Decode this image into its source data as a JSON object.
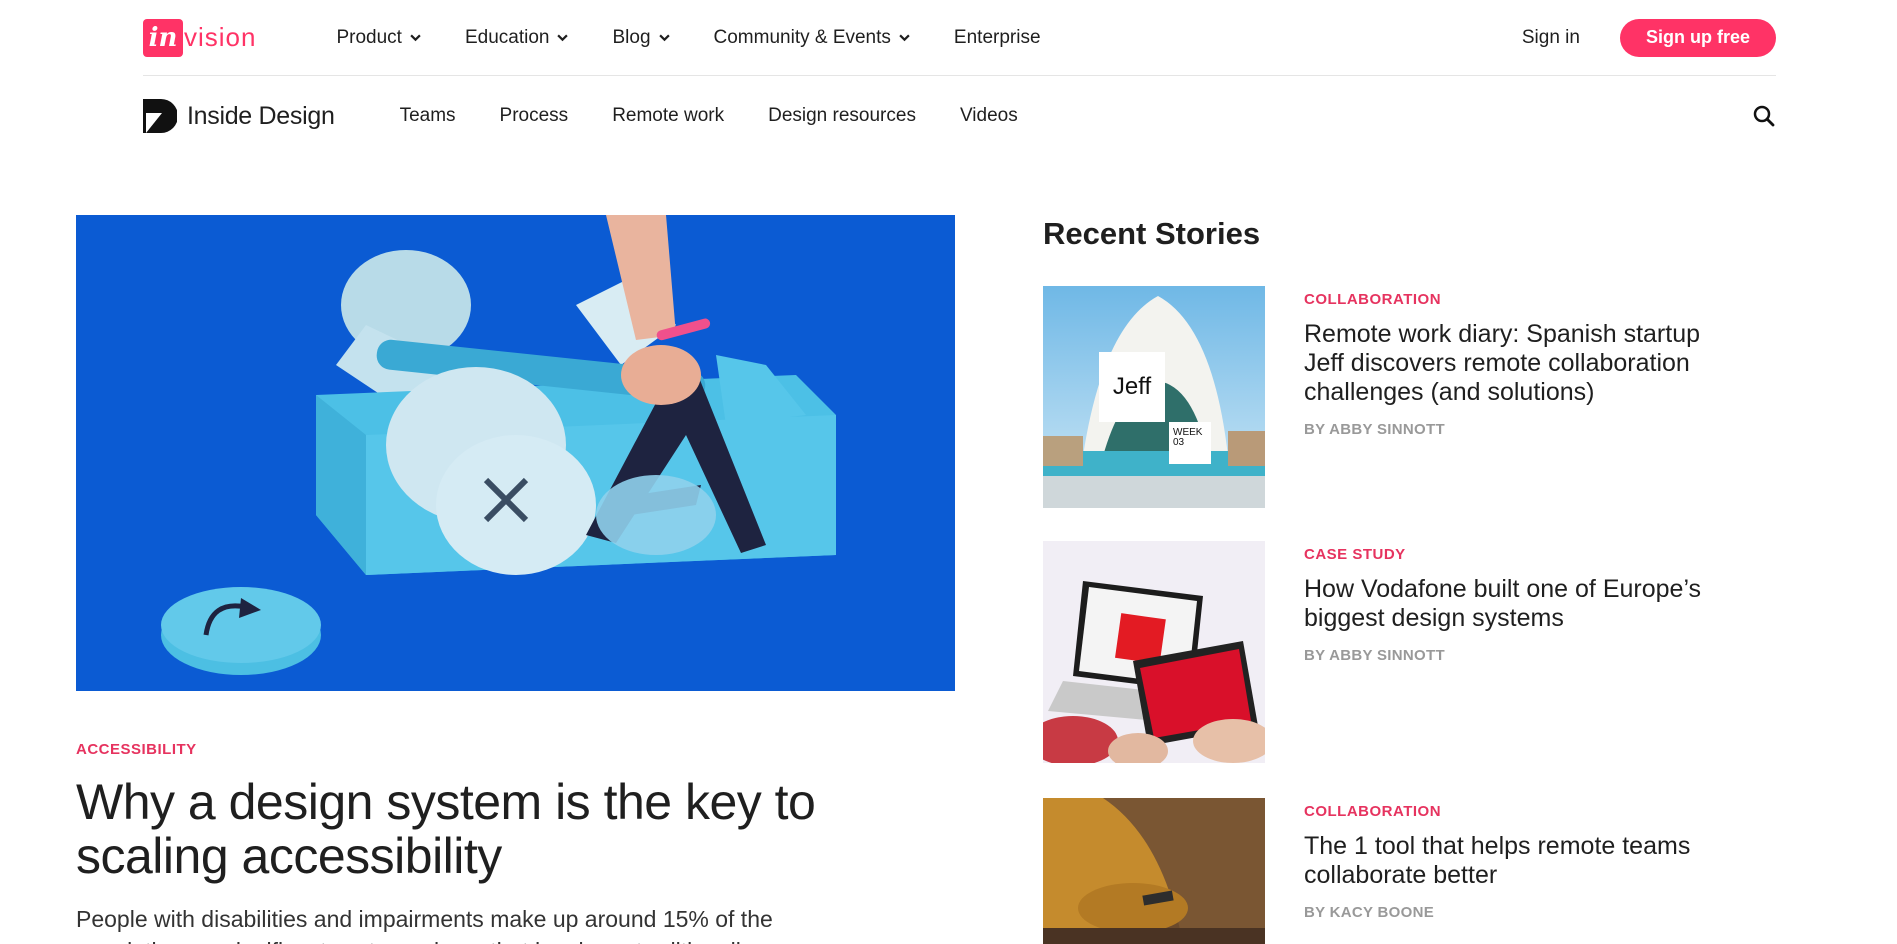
{
  "brand": {
    "logo_in": "in",
    "logo_vision": "vision",
    "accent": "#ff3366"
  },
  "topnav": {
    "items": [
      {
        "label": "Product",
        "has_dropdown": true
      },
      {
        "label": "Education",
        "has_dropdown": true
      },
      {
        "label": "Blog",
        "has_dropdown": true
      },
      {
        "label": "Community & Events",
        "has_dropdown": true
      },
      {
        "label": "Enterprise",
        "has_dropdown": false
      }
    ],
    "signin_label": "Sign in",
    "signup_label": "Sign up free"
  },
  "subnav": {
    "brand_label": "Inside Design",
    "items": [
      "Teams",
      "Process",
      "Remote work",
      "Design resources",
      "Videos"
    ],
    "search_icon": "search-icon"
  },
  "hero": {
    "category": "ACCESSIBILITY",
    "title": "Why a design system is the key to scaling accessibility",
    "description": "People with disabilities and impairments make up around 15% of the population—a significant customer base that has been traditionally"
  },
  "recent": {
    "heading": "Recent Stories",
    "stories": [
      {
        "category": "COLLABORATION",
        "title": "Remote work diary: Spanish startup Jeff discovers remote collaboration challenges (and solutions)",
        "author": "BY ABBY SINNOTT",
        "thumb_label": "Jeff",
        "thumb_badge": "WEEK 03"
      },
      {
        "category": "CASE STUDY",
        "title": "How Vodafone built one of Europe’s biggest design systems",
        "author": "BY ABBY SINNOTT"
      },
      {
        "category": "COLLABORATION",
        "title": "The 1 tool that helps remote teams collaborate better",
        "author": "BY KACY BOONE"
      }
    ]
  }
}
